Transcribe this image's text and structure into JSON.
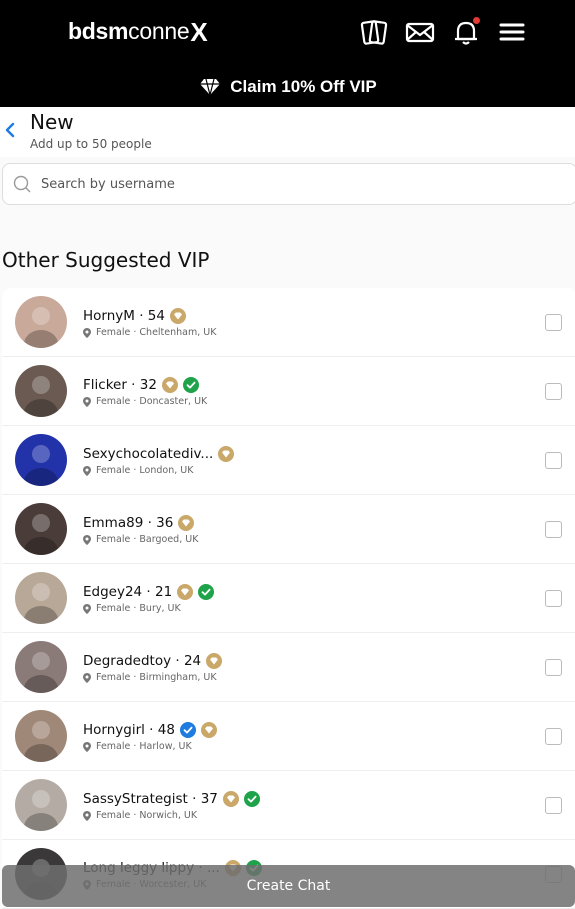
{
  "header": {
    "logo_bold": "bdsm",
    "logo_light": "conne",
    "logo_x": "X",
    "icons": [
      "cards-icon",
      "mail-icon",
      "bell-icon",
      "menu-icon"
    ],
    "notification_color": "#e53935"
  },
  "promo": {
    "label": "Claim 10% Off VIP",
    "icon": "diamond-icon"
  },
  "subheader": {
    "title": "New",
    "subtitle": "Add up to 50 people"
  },
  "search": {
    "placeholder": "Search by username",
    "value": ""
  },
  "section": {
    "title": "Other Suggested VIP"
  },
  "users": [
    {
      "name": "HornyM · 54",
      "location": "Female · Cheltenham, UK",
      "badges": [
        "vip"
      ],
      "avatar_color": "#c9a99a"
    },
    {
      "name": "Flicker · 32",
      "location": "Female · Doncaster, UK",
      "badges": [
        "vip",
        "verified-green"
      ],
      "avatar_color": "#6a5a52"
    },
    {
      "name": "Sexychocolatediv...",
      "location": "Female · London, UK",
      "badges": [
        "vip"
      ],
      "avatar_color": "#2233aa"
    },
    {
      "name": "Emma89 · 36",
      "location": "Female · Bargoed, UK",
      "badges": [
        "vip"
      ],
      "avatar_color": "#4a3c38"
    },
    {
      "name": "Edgey24 · 21",
      "location": "Female · Bury, UK",
      "badges": [
        "vip",
        "verified-green"
      ],
      "avatar_color": "#b8a898"
    },
    {
      "name": "Degradedtoy · 24",
      "location": "Female · Birmingham, UK",
      "badges": [
        "vip"
      ],
      "avatar_color": "#8a7a78"
    },
    {
      "name": "Hornygirl · 48",
      "location": "Female · Harlow, UK",
      "badges": [
        "verified-blue",
        "vip"
      ],
      "avatar_color": "#a08878"
    },
    {
      "name": "SassyStrategist · 37",
      "location": "Female · Norwich, UK",
      "badges": [
        "vip",
        "verified-green"
      ],
      "avatar_color": "#b4aca4"
    },
    {
      "name": "Long leggy lippy · ...",
      "location": "Female · Worcester, UK",
      "badges": [
        "vip",
        "verified-green"
      ],
      "avatar_color": "#3a3838"
    }
  ],
  "footer": {
    "create_label": "Create Chat"
  },
  "colors": {
    "vip_gold": "#c9a86a",
    "verified_green": "#1fa34a",
    "verified_blue": "#1e7be0",
    "accent_blue": "#1e7be0"
  }
}
